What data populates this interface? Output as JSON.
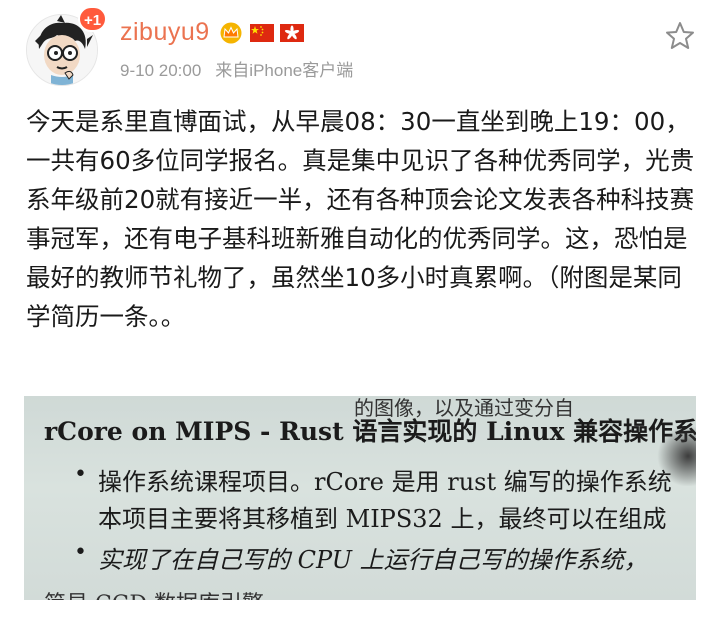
{
  "header": {
    "username": "zibuyu9",
    "notification_badge": "+1",
    "date": "9-10 20:00",
    "source": "来自iPhone客户端",
    "icons": [
      "avatar",
      "crown-icon",
      "china-flag-icon",
      "hong-kong-flag-icon",
      "star-icon"
    ],
    "colors": {
      "username": "#eb7350",
      "badge": "#ff5a3c",
      "meta": "#9a9a9a"
    }
  },
  "post": {
    "text": "今天是系里直博面试，从早晨08：30一直坐到晚上19：00，一共有60多位同学报名。真是集中见识了各种优秀同学，光贵系年级前20就有接近一半，还有各种顶会论文发表各种科技赛事冠军，还有电子基科班新雅自动化的优秀同学。这，恐怕是最好的教师节礼物了，虽然坐10多小时真累啊。（附图是某同学简历一条。。"
  },
  "photo": {
    "line0": "的图像，以及通过变分自",
    "line1": "rCore on MIPS - Rust 语言实现的 Linux 兼容操作系统",
    "bullet1": "•",
    "line2": "操作系统课程项目。rCore 是用 rust 编写的操作系统",
    "line3": "本项目主要将其移植到 MIPS32 上，最终可以在组成",
    "bullet2": "•",
    "line4": "实现了在自己写的 CPU 上运行自己写的操作系统，",
    "line5": "简易 CGD 数据库引擎"
  }
}
